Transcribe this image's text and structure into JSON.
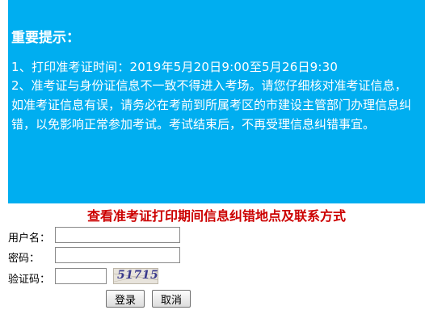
{
  "notice": {
    "title": "重要提示：",
    "line1_prefix": "1、打印准考证时间：",
    "line1_time": "2019年5月20日9:00至5月26日9:30",
    "line2": "2、准考证与身份证信息不一致不得进入考场。请您仔细核对准考证信息，如准考证信息有误，请务必在考前到所属考区的市建设主管部门办理信息纠错，以免影响正常参加考试。考试结束后，不再受理信息纠错事宜。",
    "background_color": "#00aef0"
  },
  "contact_link": "查看准考证打印期间信息纠错地点及联系方式",
  "form": {
    "username_label": "用户名：",
    "username_value": "",
    "password_label": "密码：",
    "password_value": "",
    "captcha_label": "验证码：",
    "captcha_value": "",
    "captcha_image_text": "51715"
  },
  "buttons": {
    "login": "登录",
    "cancel": "取消"
  }
}
